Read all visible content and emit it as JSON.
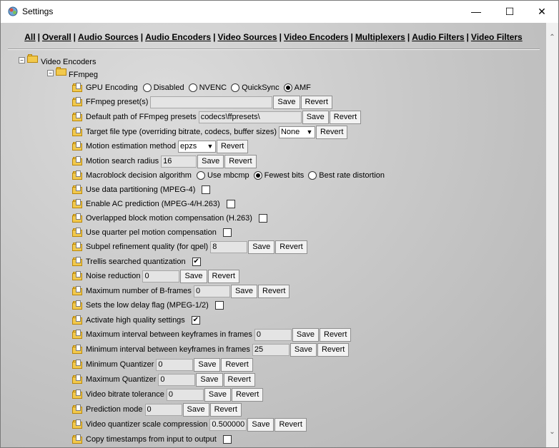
{
  "window": {
    "title": "Settings",
    "controls": {
      "minimize": "—",
      "maximize": "☐",
      "close": "✕"
    }
  },
  "nav": {
    "links": [
      "All",
      "Overall",
      "Audio Sources",
      "Audio Encoders",
      "Video Sources",
      "Video Encoders",
      "Multiplexers",
      "Audio Filters",
      "Video Filters"
    ],
    "separator": "|"
  },
  "tree": {
    "root": {
      "label": "Video Encoders",
      "toggle": "−"
    },
    "child": {
      "label": "FFmpeg",
      "toggle": "−"
    }
  },
  "buttons": {
    "save": "Save",
    "revert": "Revert"
  },
  "settings": {
    "gpu_encoding": {
      "label": "GPU Encoding",
      "options": [
        "Disabled",
        "NVENC",
        "QuickSync",
        "AMF"
      ],
      "selected": "AMF"
    },
    "ffmpeg_presets": {
      "label": "FFmpeg preset(s)",
      "value": ""
    },
    "default_path": {
      "label": "Default path of FFmpeg presets",
      "value": "codecs\\ffpresets\\"
    },
    "target_file_type": {
      "label": "Target file type (overriding bitrate, codecs, buffer sizes)",
      "value": "None"
    },
    "motion_estimation": {
      "label": "Motion estimation method",
      "value": "epzs"
    },
    "motion_search_radius": {
      "label": "Motion search radius",
      "value": "16"
    },
    "macroblock": {
      "label": "Macroblock decision algorithm",
      "options": [
        "Use mbcmp",
        "Fewest bits",
        "Best rate distortion"
      ],
      "selected": "Fewest bits"
    },
    "data_partitioning": {
      "label": "Use data partitioning (MPEG-4)",
      "checked": false
    },
    "ac_prediction": {
      "label": "Enable AC prediction (MPEG-4/H.263)",
      "checked": false
    },
    "obmc": {
      "label": "Overlapped block motion compensation (H.263)",
      "checked": false
    },
    "qpel": {
      "label": "Use quarter pel motion compensation",
      "checked": false
    },
    "subpel": {
      "label": "Subpel refinement quality (for qpel)",
      "value": "8"
    },
    "trellis": {
      "label": "Trellis searched quantization",
      "checked": true
    },
    "noise_reduction": {
      "label": "Noise reduction",
      "value": "0"
    },
    "max_bframes": {
      "label": "Maximum number of B-frames",
      "value": "0"
    },
    "low_delay": {
      "label": "Sets the low delay flag (MPEG-1/2)",
      "checked": false
    },
    "high_quality": {
      "label": "Activate high quality settings",
      "checked": true
    },
    "max_keyint": {
      "label": "Maximum interval between keyframes in frames",
      "value": "0"
    },
    "min_keyint": {
      "label": "Minimum interval between keyframes in frames",
      "value": "25"
    },
    "min_quantizer": {
      "label": "Minimum Quantizer",
      "value": "0"
    },
    "max_quantizer": {
      "label": "Maximum Quantizer",
      "value": "0"
    },
    "bitrate_tolerance": {
      "label": "Video bitrate tolerance",
      "value": "0"
    },
    "prediction_mode": {
      "label": "Prediction mode",
      "value": "0"
    },
    "qcompress": {
      "label": "Video quantizer scale compression",
      "value": "0.500000"
    },
    "copy_timestamps": {
      "label": "Copy timestamps from input to output",
      "checked": false
    }
  }
}
